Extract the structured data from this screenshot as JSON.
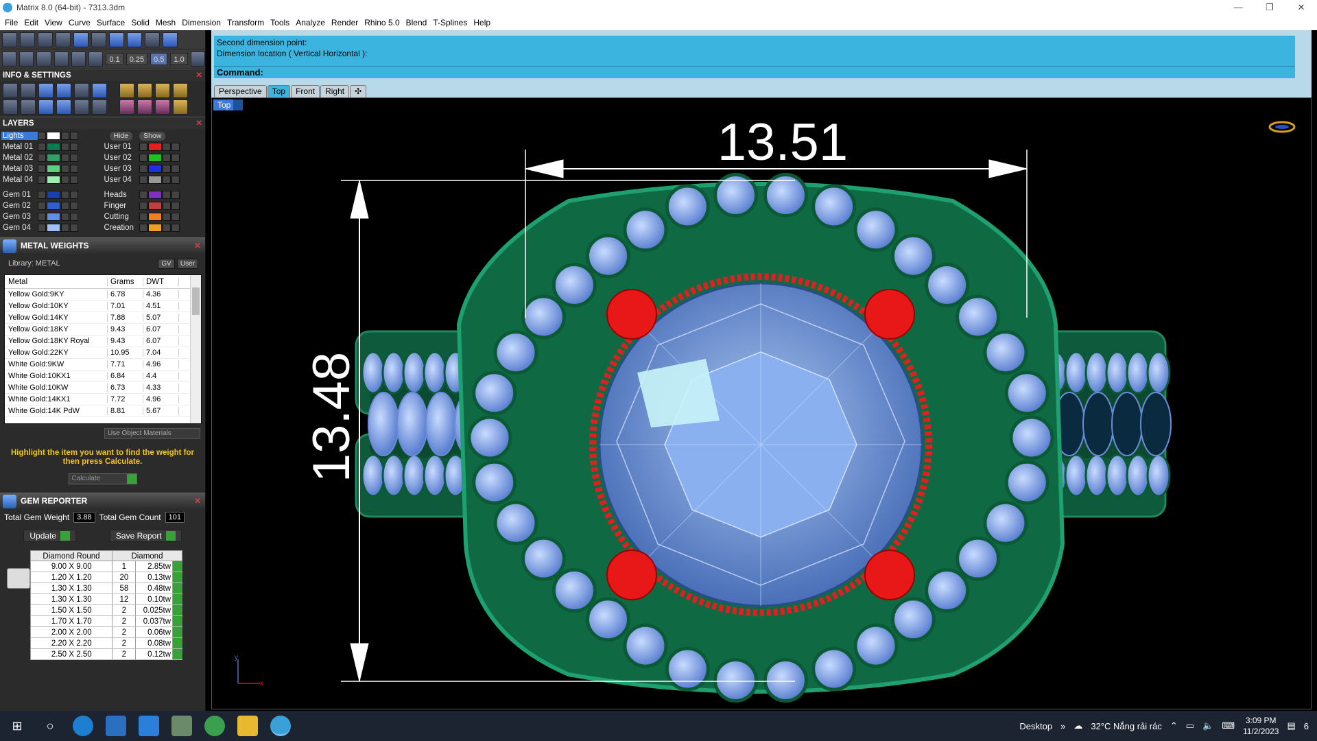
{
  "window": {
    "title": "Matrix 8.0 (64-bit) - 7313.3dm",
    "minimize": "—",
    "maximize": "❐",
    "close": "✕"
  },
  "menu": [
    "File",
    "Edit",
    "View",
    "Curve",
    "Surface",
    "Solid",
    "Mesh",
    "Dimension",
    "Transform",
    "Tools",
    "Analyze",
    "Render",
    "Rhino 5.0",
    "Blend",
    "T-Splines",
    "Help"
  ],
  "toolbar": {
    "zoom_steps": [
      "0.1",
      "0.25",
      "0.5",
      "1.0"
    ]
  },
  "info_settings": {
    "title": "INFO & SETTINGS"
  },
  "layers": {
    "title": "LAYERS",
    "hide_label": "Hide",
    "show_label": "Show",
    "lights": "Lights",
    "rows": [
      [
        {
          "name": "Metal 01",
          "color": "#0f7a52"
        },
        {
          "name": "User 01",
          "color": "#e02020"
        }
      ],
      [
        {
          "name": "Metal 02",
          "color": "#2fa068"
        },
        {
          "name": "User 02",
          "color": "#20c020"
        }
      ],
      [
        {
          "name": "Metal 03",
          "color": "#5fd080"
        },
        {
          "name": "User 03",
          "color": "#2030e0"
        }
      ],
      [
        {
          "name": "Metal 04",
          "color": "#9ff0b0"
        },
        {
          "name": "User 04",
          "color": "#999999"
        }
      ],
      [
        {
          "name": "Gem 01",
          "color": "#1a3fb0"
        },
        {
          "name": "Heads",
          "color": "#8030c0"
        }
      ],
      [
        {
          "name": "Gem 02",
          "color": "#3060d0"
        },
        {
          "name": "Finger",
          "color": "#c04040"
        }
      ],
      [
        {
          "name": "Gem 03",
          "color": "#6090e8"
        },
        {
          "name": "Cutting",
          "color": "#f08020"
        }
      ],
      [
        {
          "name": "Gem 04",
          "color": "#a0c0f8"
        },
        {
          "name": "Creation",
          "color": "#f0a020"
        }
      ]
    ]
  },
  "metal_weights": {
    "title": "METAL WEIGHTS",
    "library_label": "Library: METAL",
    "gv_label": "GV",
    "user_label": "User",
    "headers": [
      "Metal",
      "Grams",
      "DWT"
    ],
    "rows": [
      [
        "Yellow Gold:9KY",
        "6.78",
        "4.36"
      ],
      [
        "Yellow Gold:10KY",
        "7.01",
        "4.51"
      ],
      [
        "Yellow Gold:14KY",
        "7.88",
        "5.07"
      ],
      [
        "Yellow Gold:18KY",
        "9.43",
        "6.07"
      ],
      [
        "Yellow Gold:18KY Royal",
        "9.43",
        "6.07"
      ],
      [
        "Yellow Gold:22KY",
        "10.95",
        "7.04"
      ],
      [
        "White Gold:9KW",
        "7.71",
        "4.96"
      ],
      [
        "White Gold:10KX1",
        "6.84",
        "4.4"
      ],
      [
        "White Gold:10KW",
        "6.73",
        "4.33"
      ],
      [
        "White Gold:14KX1",
        "7.72",
        "4.96"
      ],
      [
        "White Gold:14K PdW",
        "8.81",
        "5.67"
      ]
    ],
    "use_object_materials": "Use Object Materials",
    "hint": "Highlight the item you want to find the weight for then press Calculate.",
    "calculate": "Calculate"
  },
  "gem_reporter": {
    "title": "GEM REPORTER",
    "total_weight_label": "Total Gem Weight",
    "total_weight": "3.88",
    "total_count_label": "Total Gem Count",
    "total_count": "101",
    "update": "Update",
    "save_report": "Save Report",
    "headers": [
      "Diamond Round",
      "Diamond"
    ],
    "rows": [
      [
        "9.00 X 9.00",
        "1",
        "2.85tw"
      ],
      [
        "1.20 X 1.20",
        "20",
        "0.13tw"
      ],
      [
        "1.30 X 1.30",
        "58",
        "0.48tw"
      ],
      [
        "1.30 X 1.30",
        "12",
        "0.10tw"
      ],
      [
        "1.50 X 1.50",
        "2",
        "0.025tw"
      ],
      [
        "1.70 X 1.70",
        "2",
        "0.037tw"
      ],
      [
        "2.00 X 2.00",
        "2",
        "0.06tw"
      ],
      [
        "2.20 X 2.20",
        "2",
        "0.08tw"
      ],
      [
        "2.50 X 2.50",
        "2",
        "0.12tw"
      ]
    ]
  },
  "command": {
    "history": [
      "Second dimension point:",
      "Dimension location ( Vertical  Horizontal ):"
    ],
    "label": "Command:"
  },
  "viewport_tabs": [
    "Perspective",
    "Top",
    "Front",
    "Right",
    "✣"
  ],
  "active_tab": "Top",
  "viewport": {
    "label": "Top",
    "dim_horizontal": "13.51",
    "dim_vertical": "13.48",
    "axis_x": "x",
    "axis_y": "y"
  },
  "taskbar": {
    "desktop": "Desktop",
    "weather": "32°C  Nắng rải rác",
    "time": "3:09 PM",
    "date": "11/2/2023",
    "notif": "6"
  }
}
